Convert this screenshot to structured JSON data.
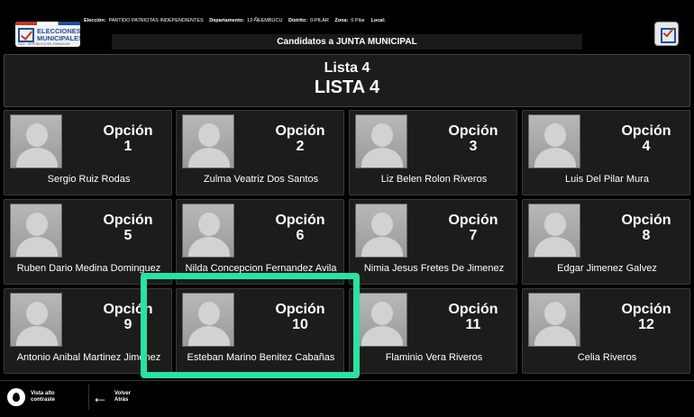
{
  "header": {
    "logo": {
      "line1": "ELECCIONES",
      "line2": "MUNICIPALES",
      "tagline": "2021 · REPÚBLICA DEL PARAGUAY"
    },
    "meta": [
      {
        "label": "Elección:",
        "value": "PARTIDO PATRIOTAS INDEPENDIENTES"
      },
      {
        "label": "Departamento:",
        "value": "12-ÑEEMBUCU"
      },
      {
        "label": "Distrito:",
        "value": "0-PILAR"
      },
      {
        "label": "Zona:",
        "value": "0 Pilar"
      },
      {
        "label": "Local:",
        "value": ""
      }
    ],
    "title": "Candidatos a JUNTA MUNICIPAL"
  },
  "lista": {
    "number": "Lista  4",
    "name": "LISTA 4"
  },
  "option_label": "Opción",
  "candidates": [
    {
      "option": "1",
      "name": "Sergio Ruiz Rodas"
    },
    {
      "option": "2",
      "name": "Zulma Veatriz Dos Santos"
    },
    {
      "option": "3",
      "name": "Liz Belen Rolon Riveros"
    },
    {
      "option": "4",
      "name": "Luis Del Pilar Mura"
    },
    {
      "option": "5",
      "name": "Ruben Dario Medina Dominguez"
    },
    {
      "option": "6",
      "name": "Nilda Concepcion Fernandez Avila"
    },
    {
      "option": "7",
      "name": "Nimia Jesus Fretes De Jimenez"
    },
    {
      "option": "8",
      "name": "Edgar Jimenez Galvez"
    },
    {
      "option": "9",
      "name": "Antonio Anibal Martinez Jimenez"
    },
    {
      "option": "10",
      "name": "Esteban Marino Benitez Cabañas"
    },
    {
      "option": "11",
      "name": "Flaminio Vera Riveros"
    },
    {
      "option": "12",
      "name": "Celia Riveros"
    }
  ],
  "footer": {
    "contrast": {
      "line1": "Vista alto",
      "line2": "contraste",
      "icon": "contrast-icon"
    },
    "back": {
      "line1": "Volver",
      "line2": "Atrás",
      "icon": "arrow-left-icon"
    }
  },
  "colors": {
    "highlight": "#29e3a0",
    "card_bg": "#1c1c1c",
    "page_bg": "#000000"
  }
}
